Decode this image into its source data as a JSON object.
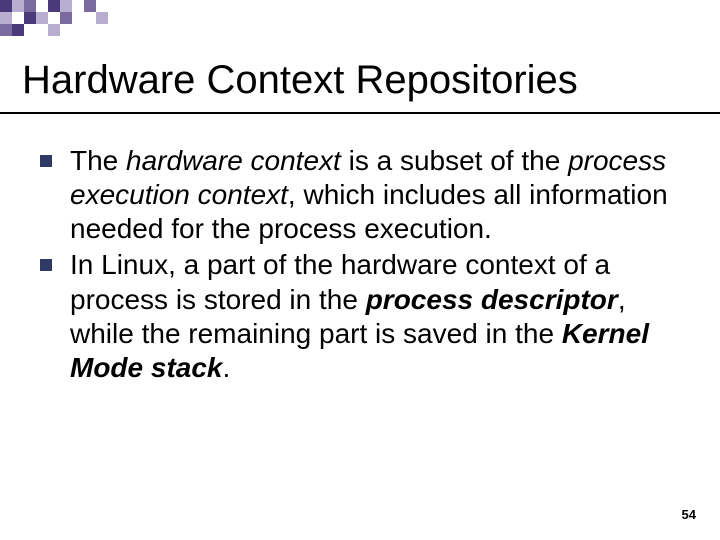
{
  "title": "Hardware Context Repositories",
  "bullets": [
    {
      "runs": [
        {
          "t": "The ",
          "c": ""
        },
        {
          "t": "hardware context",
          "c": "em1"
        },
        {
          "t": " is a subset of the ",
          "c": ""
        },
        {
          "t": "process execution context",
          "c": "em1"
        },
        {
          "t": ", which includes all information needed for the process execution.",
          "c": ""
        }
      ]
    },
    {
      "runs": [
        {
          "t": "In Linux, a part of the hardware context of a process is stored in the ",
          "c": ""
        },
        {
          "t": "process descriptor",
          "c": "em2"
        },
        {
          "t": ", while the remaining part is saved in the ",
          "c": ""
        },
        {
          "t": "Kernel Mode stack",
          "c": "em2"
        },
        {
          "t": ".",
          "c": ""
        }
      ]
    }
  ],
  "page_number": "54",
  "colors": {
    "accent": "#2f3a66",
    "deco_dark": "#4a3a7a",
    "deco_mid": "#7a6aa0",
    "deco_light": "#b8aed0"
  }
}
